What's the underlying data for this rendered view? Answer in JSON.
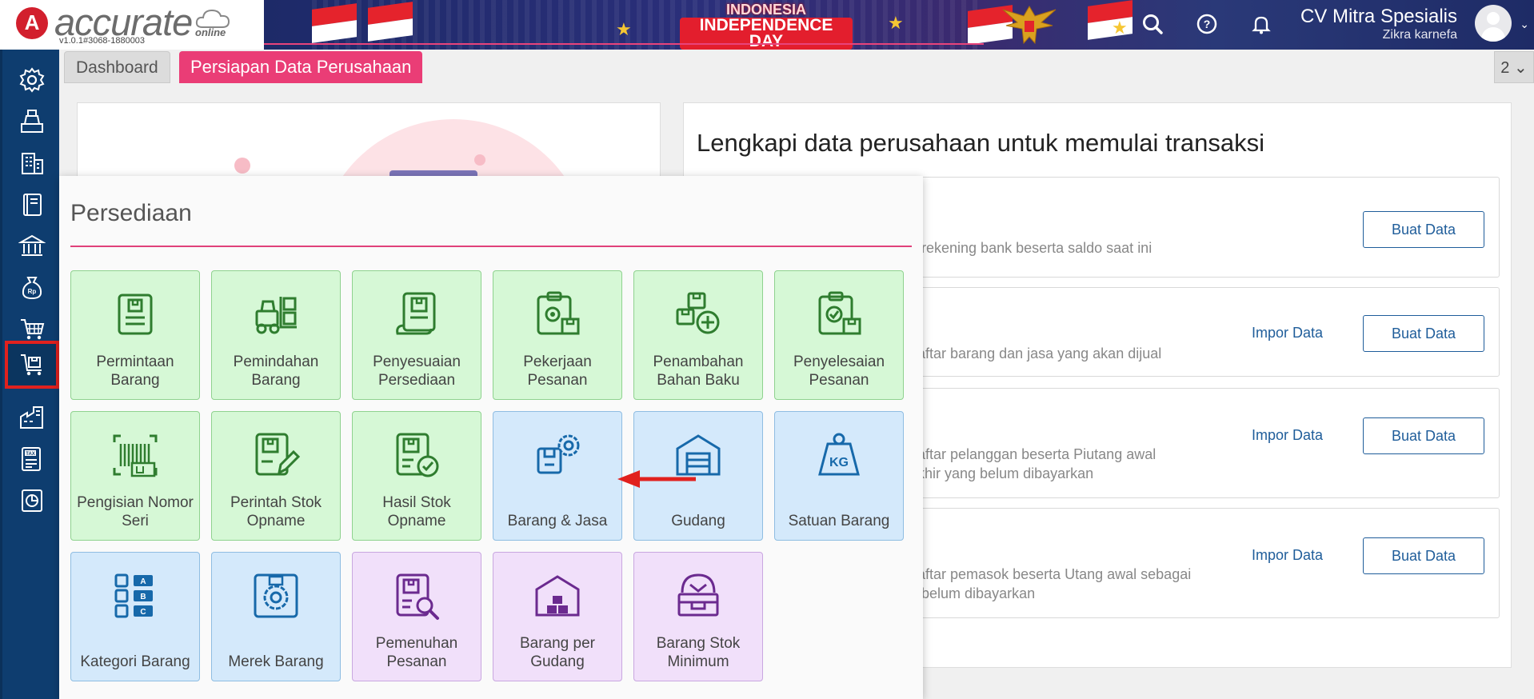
{
  "app": {
    "logo_letter": "A",
    "logo_name": "accurate",
    "logo_sub": "online",
    "version": "v1.0.1#3068-1880003"
  },
  "banner": {
    "line1": "INDONESIA",
    "line2": "INDEPENDENCE DAY"
  },
  "header": {
    "company_name": "CV Mitra Spesialis",
    "user_name": "Zikra karnefa"
  },
  "tabs": [
    {
      "label": "Dashboard"
    },
    {
      "label": "Persiapan Data Perusahaan"
    }
  ],
  "tab_count": "2",
  "main": {
    "title": "Lengkapi data perusahaan untuk memulai transaksi",
    "tasks": [
      {
        "desc": "n rekening bank beserta saldo saat ini",
        "impor": "",
        "buat": "Buat Data"
      },
      {
        "desc": "daftar barang dan jasa yang akan dijual",
        "impor": "Impor Data",
        "buat": "Buat Data"
      },
      {
        "desc": "daftar pelanggan beserta Piutang awal\nakhir yang belum dibayarkan",
        "impor": "Impor Data",
        "buat": "Buat Data"
      },
      {
        "desc": "daftar pemasok beserta Utang awal sebagai\ng belum dibayarkan",
        "impor": "Impor Data",
        "buat": "Buat Data"
      }
    ]
  },
  "popup": {
    "title": "Persediaan",
    "tiles": [
      {
        "label": "Permintaan Barang",
        "color": "green",
        "icon": "request-doc-icon"
      },
      {
        "label": "Pemindahan Barang",
        "color": "green",
        "icon": "forklift-icon"
      },
      {
        "label": "Penyesuaian Persediaan",
        "color": "green",
        "icon": "adjust-doc-icon"
      },
      {
        "label": "Pekerjaan Pesanan",
        "color": "green",
        "icon": "clipboard-gear-icon"
      },
      {
        "label": "Penambahan Bahan Baku",
        "color": "green",
        "icon": "boxes-plus-icon"
      },
      {
        "label": "Penyelesaian Pesanan",
        "color": "green",
        "icon": "clipboard-check-icon"
      },
      {
        "label": "Pengisian Nomor Seri",
        "color": "green",
        "icon": "barcode-icon"
      },
      {
        "label": "Perintah Stok Opname",
        "color": "green",
        "icon": "doc-pencil-icon"
      },
      {
        "label": "Hasil Stok Opname",
        "color": "green",
        "icon": "doc-check-icon"
      },
      {
        "label": "Barang & Jasa",
        "color": "blue",
        "icon": "box-gear-icon"
      },
      {
        "label": "Gudang",
        "color": "blue",
        "icon": "warehouse-icon"
      },
      {
        "label": "Satuan Barang",
        "color": "blue",
        "icon": "weight-kg-icon"
      },
      {
        "label": "Kategori Barang",
        "color": "blue",
        "icon": "category-list-icon"
      },
      {
        "label": "Merek Barang",
        "color": "blue",
        "icon": "brand-badge-icon"
      },
      {
        "label": "Pemenuhan Pesanan",
        "color": "purple",
        "icon": "doc-search-icon"
      },
      {
        "label": "Barang per Gudang",
        "color": "purple",
        "icon": "warehouse-boxes-icon"
      },
      {
        "label": "Barang Stok Minimum",
        "color": "purple",
        "icon": "box-minimum-icon"
      }
    ]
  },
  "sidebar": {
    "items": [
      {
        "icon": "gear-icon"
      },
      {
        "icon": "cashier-icon"
      },
      {
        "icon": "building-icon"
      },
      {
        "icon": "ledger-book-icon"
      },
      {
        "icon": "bank-icon"
      },
      {
        "icon": "money-bag-icon"
      },
      {
        "icon": "shopping-cart-icon"
      },
      {
        "icon": "inventory-cart-icon"
      },
      {
        "icon": "factory-icon"
      },
      {
        "icon": "tax-document-icon"
      },
      {
        "icon": "report-chart-icon"
      }
    ]
  },
  "colors": {
    "sidebar": "#0e3d6f",
    "accent_pink": "#ea3d76",
    "brand_red": "#d21f2d",
    "tile_green": "#d6f8d6",
    "tile_blue": "#d4e9fb",
    "tile_purple": "#f1e0fa",
    "link_blue": "#1f5d9a"
  }
}
